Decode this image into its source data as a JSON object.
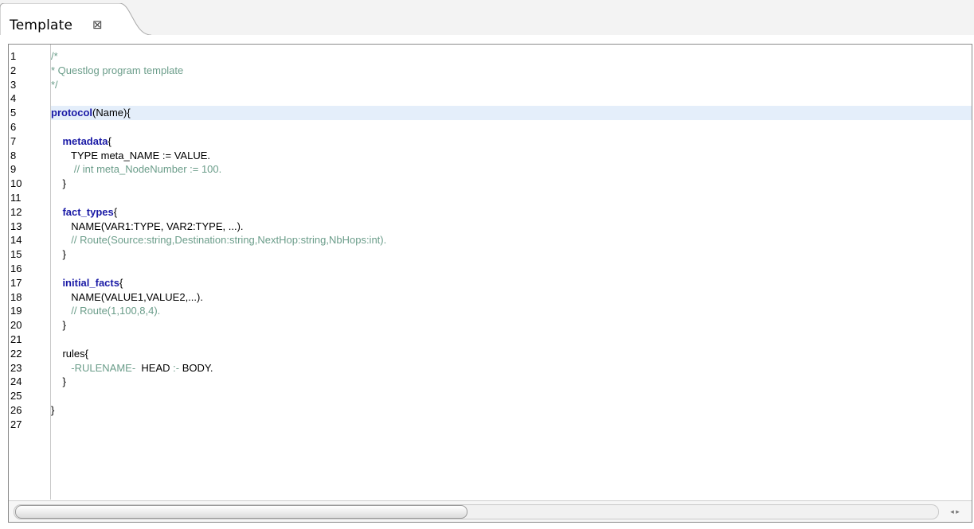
{
  "tab": {
    "title": "Template",
    "close_icon": "close-icon"
  },
  "editor": {
    "line_numbers": [
      "1",
      "2",
      "3",
      "4",
      "5",
      "6",
      "7",
      "8",
      "9",
      "10",
      "11",
      "12",
      "13",
      "14",
      "15",
      "16",
      "17",
      "18",
      "19",
      "20",
      "21",
      "22",
      "23",
      "24",
      "25",
      "26",
      "27"
    ],
    "current_line": 5,
    "lines": [
      [
        {
          "t": "/*",
          "k": "comment"
        }
      ],
      [
        {
          "t": "* Questlog program template",
          "k": "comment"
        }
      ],
      [
        {
          "t": "*/",
          "k": "comment"
        }
      ],
      [],
      [
        {
          "t": "protocol",
          "k": "keyword"
        },
        {
          "t": "(Name){",
          "k": "plain"
        }
      ],
      [],
      [
        {
          "t": "    metadata",
          "k": "keyword"
        },
        {
          "t": "{",
          "k": "plain"
        }
      ],
      [
        {
          "t": "       TYPE meta_NAME := VALUE.",
          "k": "plain"
        }
      ],
      [
        {
          "t": "        // int meta_NodeNumber := 100.",
          "k": "comment"
        }
      ],
      [
        {
          "t": "    }",
          "k": "plain"
        }
      ],
      [],
      [
        {
          "t": "    fact_types",
          "k": "keyword"
        },
        {
          "t": "{",
          "k": "plain"
        }
      ],
      [
        {
          "t": "       NAME(VAR1:TYPE, VAR2:TYPE, ...).",
          "k": "plain"
        }
      ],
      [
        {
          "t": "       // Route(Source:string,Destination:string,NextHop:string,NbHops:int).",
          "k": "comment"
        }
      ],
      [
        {
          "t": "    }",
          "k": "plain"
        }
      ],
      [],
      [
        {
          "t": "    initial_facts",
          "k": "keyword"
        },
        {
          "t": "{",
          "k": "plain"
        }
      ],
      [
        {
          "t": "       NAME(VALUE1,VALUE2,...).",
          "k": "plain"
        }
      ],
      [
        {
          "t": "       // Route(1,100,8,4).",
          "k": "comment"
        }
      ],
      [
        {
          "t": "    }",
          "k": "plain"
        }
      ],
      [],
      [
        {
          "t": "    rules{",
          "k": "plain"
        }
      ],
      [
        {
          "t": "       -RULENAME-",
          "k": "comment"
        },
        {
          "t": "  HEAD ",
          "k": "plain"
        },
        {
          "t": ":-",
          "k": "comment"
        },
        {
          "t": " BODY.",
          "k": "plain"
        }
      ],
      [
        {
          "t": "    }",
          "k": "plain"
        }
      ],
      [],
      [
        {
          "t": "}",
          "k": "plain"
        }
      ],
      []
    ]
  },
  "scrollbar": {
    "arrows": "◂ ▸"
  },
  "colors": {
    "comment": "#6b9d8a",
    "keyword": "#1a1aa6",
    "current_line_bg": "#e4eefa"
  }
}
